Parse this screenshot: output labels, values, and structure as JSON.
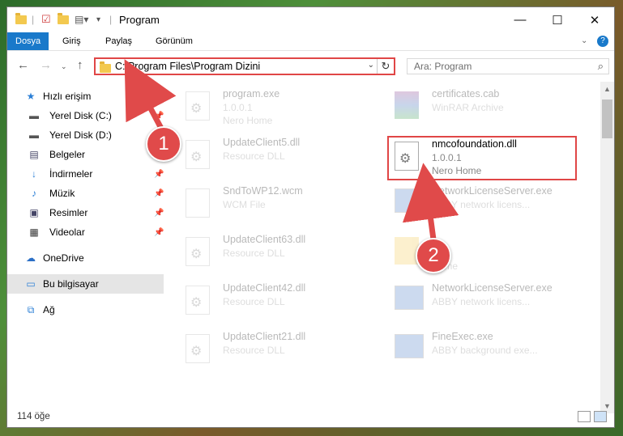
{
  "window": {
    "title": "Program"
  },
  "ribbon": {
    "tabs": [
      "Dosya",
      "Giriş",
      "Paylaş",
      "Görünüm"
    ]
  },
  "address": {
    "path": "C:\\Program Files\\Program Dizini"
  },
  "search": {
    "placeholder": "Ara: Program"
  },
  "sidebar": {
    "items": [
      {
        "label": "Hızlı erişim",
        "icon": "star-icon"
      },
      {
        "label": "Yerel Disk (C:)",
        "icon": "drive-icon"
      },
      {
        "label": "Yerel Disk (D:)",
        "icon": "drive-icon"
      },
      {
        "label": "Belgeler",
        "icon": "documents-icon"
      },
      {
        "label": "İndirmeler",
        "icon": "download-icon"
      },
      {
        "label": "Müzik",
        "icon": "music-icon"
      },
      {
        "label": "Resimler",
        "icon": "pictures-icon"
      },
      {
        "label": "Videolar",
        "icon": "videos-icon"
      },
      {
        "label": "OneDrive",
        "icon": "cloud-icon"
      },
      {
        "label": "Bu bilgisayar",
        "icon": "computer-icon"
      },
      {
        "label": "Ağ",
        "icon": "network-icon"
      }
    ]
  },
  "files": {
    "left": [
      {
        "name": "program.exe",
        "desc": "1.0.0.1",
        "desc2": "Nero Home"
      },
      {
        "name": "UpdateClient5.dll",
        "desc": "Resource DLL"
      },
      {
        "name": "SndToWP12.wcm",
        "desc": "WCM File"
      },
      {
        "name": "UpdateClient63.dll",
        "desc": "Resource DLL"
      },
      {
        "name": "UpdateClient42.dll",
        "desc": "Resource DLL"
      },
      {
        "name": "UpdateClient21.dll",
        "desc": "Resource DLL"
      }
    ],
    "right": [
      {
        "name": "certificates.cab",
        "desc": "WinRAR Archive"
      },
      {
        "name": "nmcofoundation.dll",
        "desc": "1.0.0.1",
        "desc2": "Nero Home"
      },
      {
        "name": "NetworkLicenseServer.exe",
        "desc": "ABBY network licens..."
      },
      {
        "name": "",
        "desc": "Home"
      },
      {
        "name": "NetworkLicenseServer.exe",
        "desc": "ABBY network licens..."
      },
      {
        "name": "FineExec.exe",
        "desc": "ABBY background exe..."
      }
    ]
  },
  "status": {
    "count": "114 öğe"
  },
  "badges": {
    "one": "1",
    "two": "2"
  },
  "colors": {
    "accent": "#1979ca",
    "highlight": "#e04646"
  }
}
